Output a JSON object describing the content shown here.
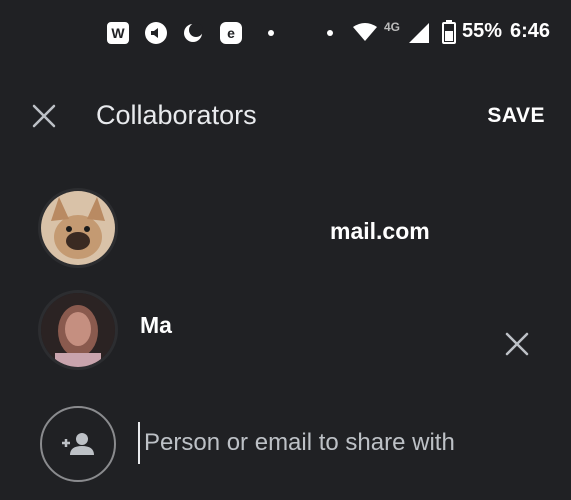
{
  "status_bar": {
    "icons": [
      "wiki-icon",
      "volume-icon",
      "moon-icon",
      "e-icon"
    ],
    "network": "4G",
    "battery": "55%",
    "time": "6:46"
  },
  "header": {
    "title": "Collaborators",
    "save_label": "SAVE"
  },
  "collaborators": [
    {
      "avatar": "dog-avatar",
      "email": "mail.com"
    },
    {
      "avatar": "person-avatar",
      "name": "Ma"
    }
  ],
  "share": {
    "placeholder": "Person or email to share with"
  },
  "colors": {
    "background": "#202124",
    "text": "#e8eaed"
  }
}
